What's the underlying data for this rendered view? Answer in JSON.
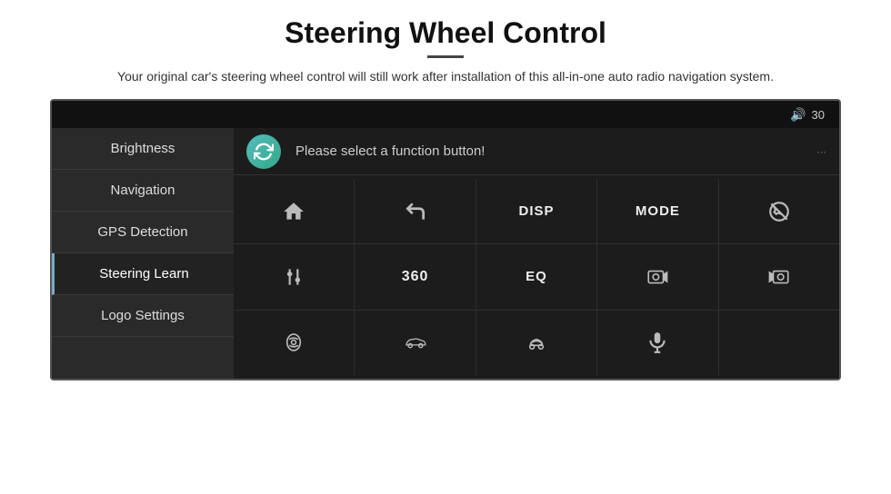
{
  "header": {
    "title": "Steering Wheel Control",
    "subtitle": "Your original car's steering wheel control will still work after installation of this all-in-one auto radio navigation system."
  },
  "topbar": {
    "volume_label": "30"
  },
  "function_prompt": "Please select a function button!",
  "sidebar": {
    "items": [
      {
        "id": "brightness",
        "label": "Brightness",
        "active": false
      },
      {
        "id": "navigation",
        "label": "Navigation",
        "active": false
      },
      {
        "id": "gps-detection",
        "label": "GPS Detection",
        "active": false
      },
      {
        "id": "steering-learn",
        "label": "Steering Learn",
        "active": true
      },
      {
        "id": "logo-settings",
        "label": "Logo Settings",
        "active": false
      }
    ]
  },
  "grid": {
    "row1": [
      {
        "id": "home",
        "type": "icon",
        "label": "home"
      },
      {
        "id": "back",
        "type": "icon",
        "label": "back"
      },
      {
        "id": "disp",
        "type": "text",
        "label": "DISP"
      },
      {
        "id": "mode",
        "type": "text",
        "label": "MODE"
      },
      {
        "id": "no-call",
        "type": "icon",
        "label": "no-call"
      }
    ],
    "row2": [
      {
        "id": "tune",
        "type": "icon",
        "label": "tune"
      },
      {
        "id": "360",
        "type": "text",
        "label": "360"
      },
      {
        "id": "eq",
        "type": "text",
        "label": "EQ"
      },
      {
        "id": "cam-front",
        "type": "icon",
        "label": "cam-front"
      },
      {
        "id": "cam-rear",
        "type": "icon",
        "label": "cam-rear"
      }
    ],
    "row3": [
      {
        "id": "car1",
        "type": "icon",
        "label": "car-top"
      },
      {
        "id": "car2",
        "type": "icon",
        "label": "car-side"
      },
      {
        "id": "car3",
        "type": "icon",
        "label": "car-front"
      },
      {
        "id": "mic",
        "type": "icon",
        "label": "microphone"
      },
      {
        "id": "empty",
        "type": "empty",
        "label": ""
      }
    ]
  }
}
